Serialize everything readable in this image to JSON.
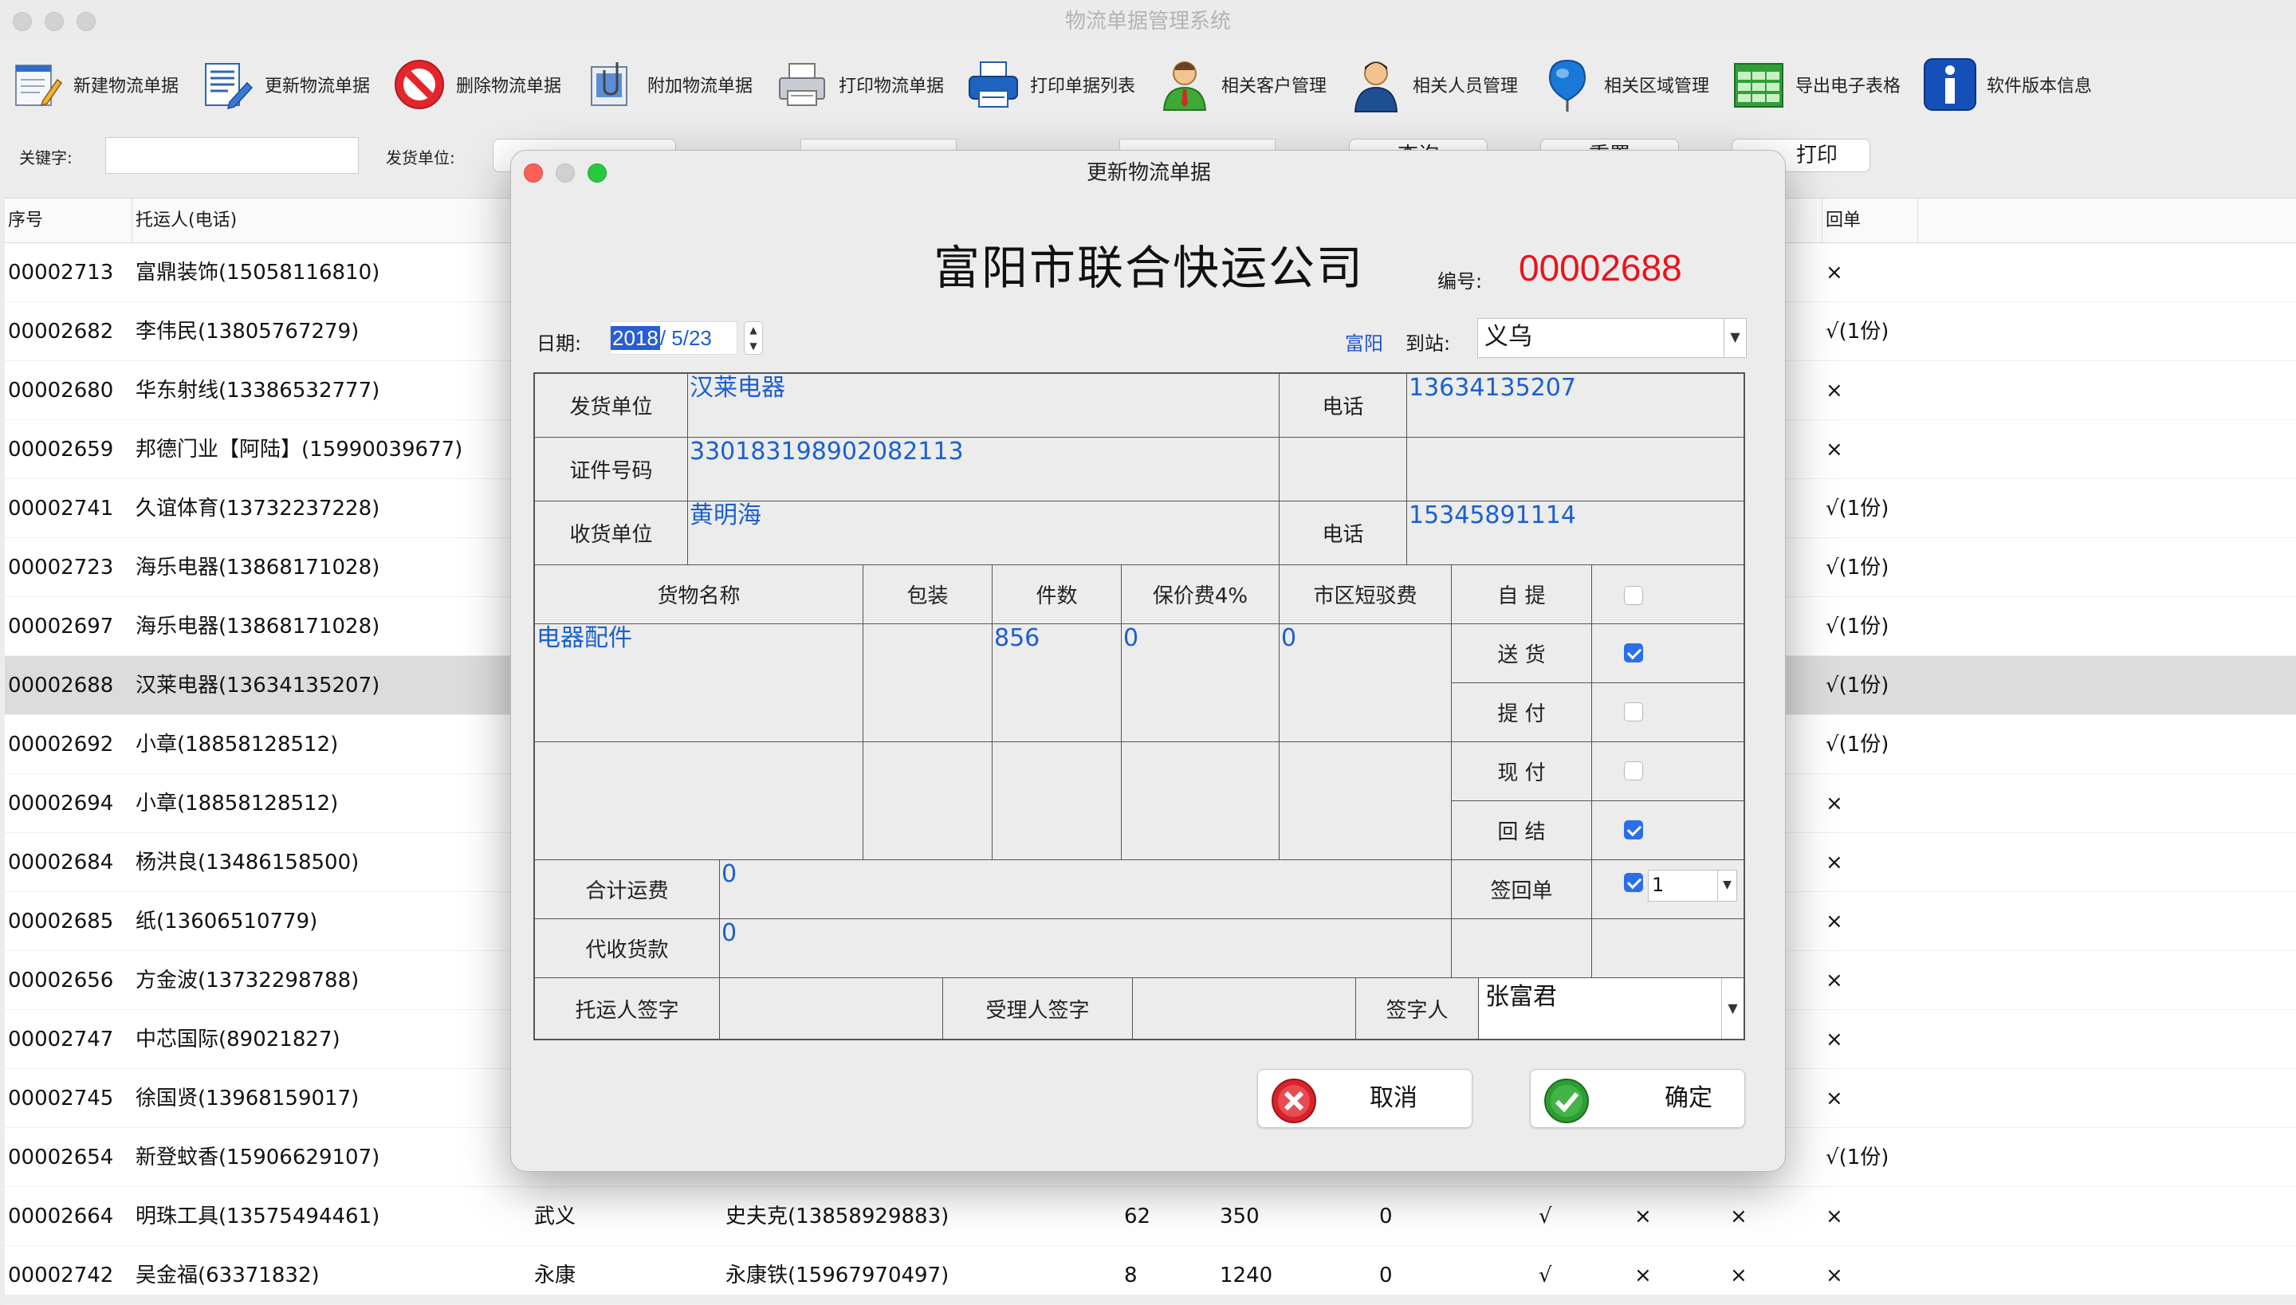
{
  "window": {
    "title": "物流单据管理系统"
  },
  "toolbar": [
    {
      "label": "新建物流单据",
      "icon": "new-document-icon"
    },
    {
      "label": "更新物流单据",
      "icon": "edit-document-icon"
    },
    {
      "label": "删除物流单据",
      "icon": "delete-icon"
    },
    {
      "label": "附加物流单据",
      "icon": "attach-icon"
    },
    {
      "label": "打印物流单据",
      "icon": "printer-icon"
    },
    {
      "label": "打印单据列表",
      "icon": "printer-blue-icon"
    },
    {
      "label": "相关客户管理",
      "icon": "customer-icon"
    },
    {
      "label": "相关人员管理",
      "icon": "person-icon"
    },
    {
      "label": "相关区域管理",
      "icon": "location-pin-icon"
    },
    {
      "label": "导出电子表格",
      "icon": "spreadsheet-icon"
    },
    {
      "label": "软件版本信息",
      "icon": "info-icon"
    }
  ],
  "search": {
    "keyword_label": "关键字:",
    "keyword_value": "",
    "shipper_label": "发货单位:",
    "query_label": "查询",
    "reset_label": "重置",
    "print_label": "打印"
  },
  "grid": {
    "headers": [
      "序号",
      "托运人(电话)",
      "回单"
    ],
    "rows": [
      {
        "id": "00002713",
        "shipper": "富鼎装饰(15058116810)",
        "receipt": "×"
      },
      {
        "id": "00002682",
        "shipper": "李伟民(13805767279)",
        "receipt": "√(1份)"
      },
      {
        "id": "00002680",
        "shipper": "华东射线(13386532777)",
        "receipt": "×"
      },
      {
        "id": "00002659",
        "shipper": "邦德门业【阿陆】(15990039677)",
        "receipt": "×"
      },
      {
        "id": "00002741",
        "shipper": "久谊体育(13732237228)",
        "receipt": "√(1份)"
      },
      {
        "id": "00002723",
        "shipper": "海乐电器(13868171028)",
        "receipt": "√(1份)"
      },
      {
        "id": "00002697",
        "shipper": "海乐电器(13868171028)",
        "receipt": "√(1份)"
      },
      {
        "id": "00002688",
        "shipper": "汉莱电器(13634135207)",
        "receipt": "√(1份)"
      },
      {
        "id": "00002692",
        "shipper": "小章(18858128512)",
        "receipt": "√(1份)"
      },
      {
        "id": "00002694",
        "shipper": "小章(18858128512)",
        "receipt": "×"
      },
      {
        "id": "00002684",
        "shipper": "杨洪良(13486158500)",
        "receipt": "×"
      },
      {
        "id": "00002685",
        "shipper": "纸(13606510779)",
        "receipt": "×"
      },
      {
        "id": "00002656",
        "shipper": "方金波(13732298788)",
        "receipt": "×"
      },
      {
        "id": "00002747",
        "shipper": "中芯国际(89021827)",
        "receipt": "×"
      },
      {
        "id": "00002745",
        "shipper": "徐国贤(13968159017)",
        "receipt": "×"
      },
      {
        "id": "00002654",
        "shipper": "新登蚊香(15906629107)",
        "receipt": "√(1份)"
      },
      {
        "id": "00002664",
        "shipper": "明珠工具(13575494461)",
        "dest": "武义",
        "consignee": "史夫克(13858929883)",
        "qty": "62",
        "fee": "350",
        "ins": "0",
        "c1": "√",
        "c2": "×",
        "c3": "×",
        "receipt": "×"
      },
      {
        "id": "00002742",
        "shipper": "吴金福(63371832)",
        "dest": "永康",
        "consignee": "永康铁(15967970497)",
        "qty": "8",
        "fee": "1240",
        "ins": "0",
        "c1": "√",
        "c2": "×",
        "c3": "×",
        "receipt": "×"
      }
    ]
  },
  "dialog": {
    "title": "更新物流单据",
    "company": "富阳市联合快运公司",
    "number_label": "编号:",
    "number": "00002688",
    "date_label": "日期:",
    "date_year": "2018",
    "date_rest": "/  5/23",
    "origin": "富阳",
    "dest_label": "到站:",
    "dest": "义乌",
    "shipper_label": "发货单位",
    "shipper": "汉莱电器",
    "phone_label": "电话",
    "shipper_phone": "13634135207",
    "id_label": "证件号码",
    "id_number": "330183198902082113",
    "receiver_label": "收货单位",
    "receiver": "黄明海",
    "receiver_phone": "15345891114",
    "col_goods": "货物名称",
    "col_pack": "包装",
    "col_qty": "件数",
    "col_ins": "保价费4%",
    "col_city": "市区短驳费",
    "goods": "电器配件",
    "qty": "856",
    "ins": "0",
    "city": "0",
    "opt_pickup": "自  提",
    "opt_delivery": "送  货",
    "opt_collect": "提  付",
    "opt_cash": "现  付",
    "opt_settle": "回  结",
    "total_label": "合计运费",
    "total": "0",
    "cod_label": "代收货款",
    "cod": "0",
    "receipt_label": "签回单",
    "receipt_copies": "1",
    "sig_shipper_label": "托运人签字",
    "sig_receiver_label": "受理人签字",
    "signer_label": "签字人",
    "signer": "张富君",
    "cancel_label": "取消",
    "ok_label": "确定"
  }
}
